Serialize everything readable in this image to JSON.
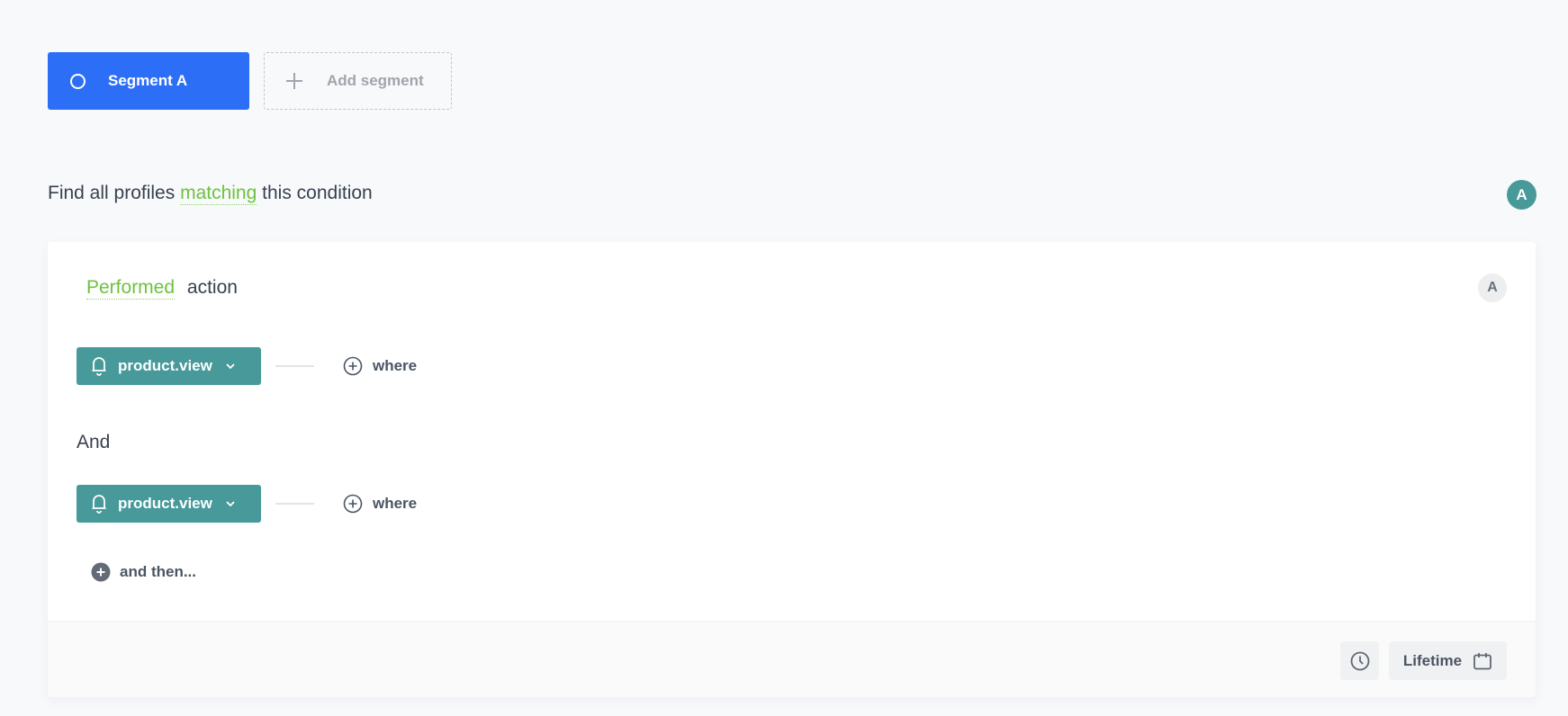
{
  "segments": {
    "active_label": "Segment A",
    "add_label": "Add segment",
    "colors": {
      "active": "#2d6ef7"
    }
  },
  "condition": {
    "prefix": "Find all profiles",
    "match_mode": "matching",
    "suffix": "this condition",
    "segment_badge": "A"
  },
  "action": {
    "mode": "Performed",
    "label": "action",
    "badge": "A",
    "events": [
      {
        "name": "product.view",
        "icon": "bell-icon",
        "where_label": "where"
      },
      {
        "name": "product.view",
        "icon": "bell-icon",
        "where_label": "where"
      }
    ],
    "joiner": "And",
    "and_then_label": "and then..."
  },
  "footer": {
    "time_range_label": "Lifetime",
    "clock_icon": "clock-icon",
    "calendar_icon": "calendar-icon"
  },
  "colors": {
    "accent_green": "#6dc23f",
    "event_teal": "#47999a",
    "text": "#384150"
  }
}
